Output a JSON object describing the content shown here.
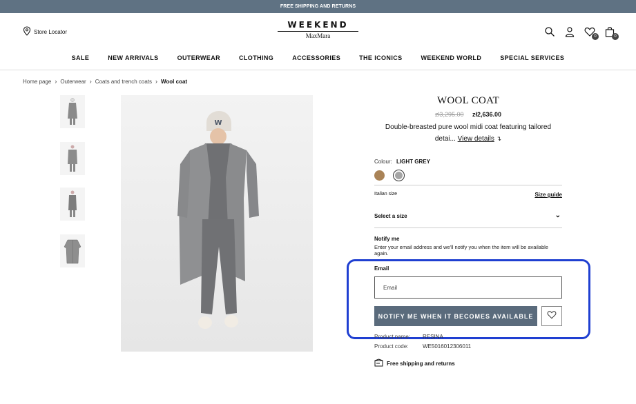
{
  "promo": {
    "text": "FREE SHIPPING AND RETURNS"
  },
  "header": {
    "store_locator": "Store Locator",
    "logo_top": "WEEKEND",
    "logo_bottom": "MaxMara",
    "wishlist_count": "0",
    "bag_count": "0"
  },
  "nav": {
    "items": [
      "SALE",
      "NEW ARRIVALS",
      "OUTERWEAR",
      "CLOTHING",
      "ACCESSORIES",
      "THE ICONICS",
      "WEEKEND WORLD",
      "SPECIAL SERVICES"
    ]
  },
  "breadcrumb": {
    "items": [
      "Home page",
      "Outerwear",
      "Coats and trench coats",
      "Wool coat"
    ]
  },
  "product": {
    "title": "WOOL COAT",
    "old_price": "zł3,295.00",
    "new_price": "zł2,636.00",
    "description_line1": "Double-breasted pure wool midi coat featuring tailored",
    "description_line2": "detai...",
    "view_details": "View details",
    "colour_label": "Colour:",
    "colour_value": "LIGHT GREY",
    "swatch_colors": [
      "#a98357",
      "#a5a5a5"
    ],
    "size_label": "Italian size",
    "size_guide": "Size guide",
    "select_size": "Select a size",
    "notify_title": "Notify me",
    "notify_text": "Enter your email address and we'll notify you when the item will be available again.",
    "email_label": "Email",
    "email_placeholder": "Email",
    "notify_button": "NOTIFY ME WHEN IT BECOMES AVAILABLE",
    "product_name_label": "Product name:",
    "product_name_value": "RESINA",
    "product_code_label": "Product code:",
    "product_code_value": "WE5016012306011",
    "shipping": "Free shipping and returns"
  }
}
